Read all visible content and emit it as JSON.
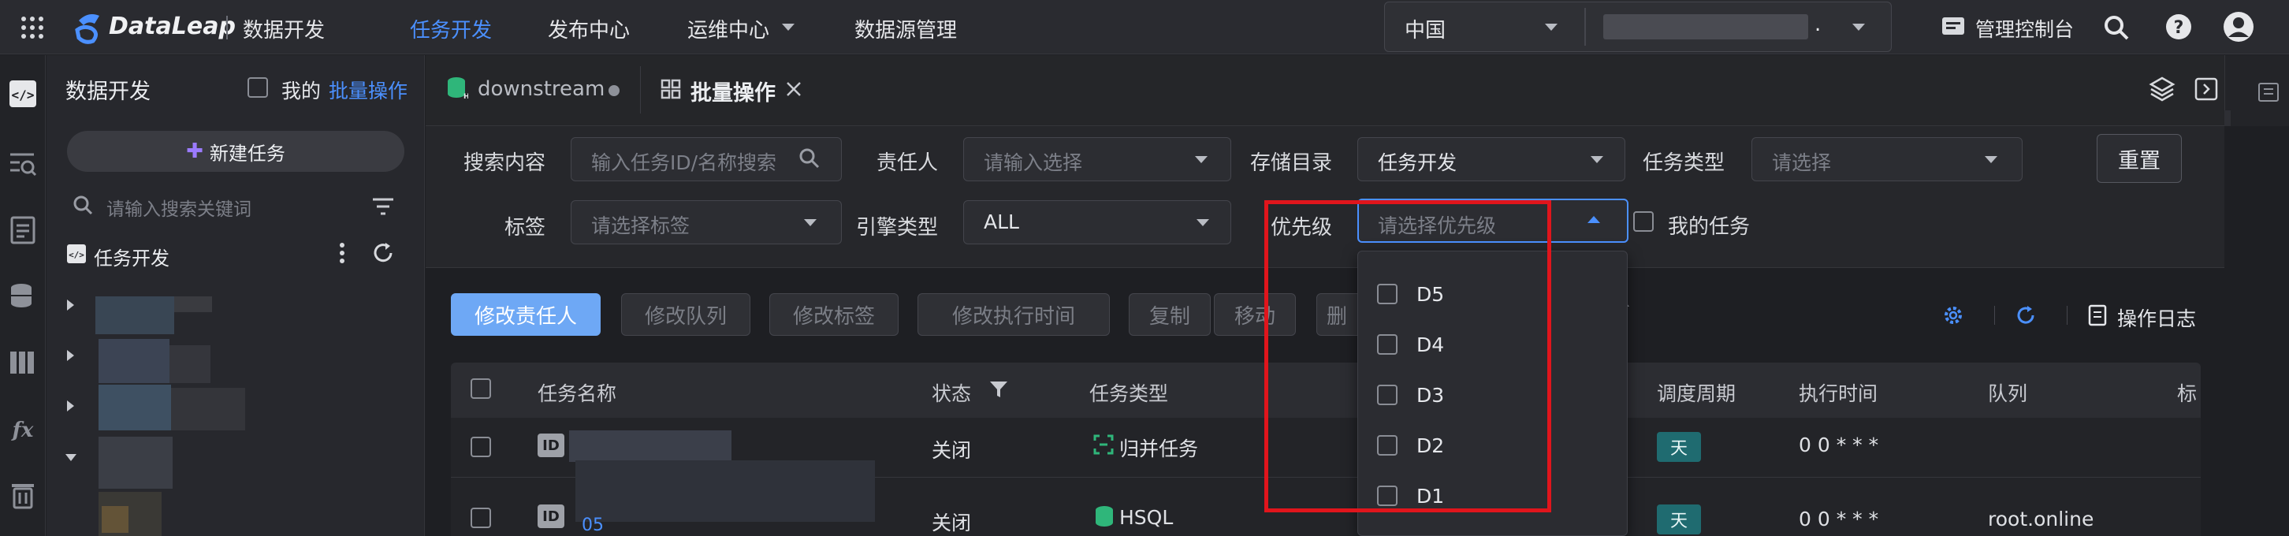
{
  "topbar": {
    "brand": "DataLeap",
    "product": "数据开发",
    "nav": [
      "任务开发",
      "发布中心",
      "运维中心",
      "数据源管理"
    ],
    "region": "中国",
    "account": ".",
    "console": "管理控制台",
    "colors": {
      "accent": "#4b90ff",
      "highlight": "#e0151c"
    }
  },
  "sidebar": {
    "title": "数据开发",
    "my_label": "我的",
    "batch_label": "批量操作",
    "new_task": "新建任务",
    "search_placeholder": "请输入搜索关键词",
    "tree_root": "任务开发"
  },
  "tabs": [
    {
      "label": "downstream"
    },
    {
      "label": "批量操作"
    }
  ],
  "filters": {
    "search_label": "搜索内容",
    "search_placeholder": "输入任务ID/名称搜索",
    "owner_label": "责任人",
    "owner_placeholder": "请输入选择",
    "dir_label": "存储目录",
    "dir_value": "任务开发",
    "type_label": "任务类型",
    "type_placeholder": "请选择",
    "reset": "重置",
    "tag_label": "标签",
    "tag_placeholder": "请选择标签",
    "engine_label": "引擎类型",
    "engine_value": "ALL",
    "priority_label": "优先级",
    "priority_placeholder": "请选择优先级",
    "my_tasks": "我的任务"
  },
  "actions": {
    "buttons": [
      "修改责任人",
      "修改队列",
      "修改标签",
      "修改执行时间",
      "复制",
      "移动",
      "删"
    ],
    "log": "操作日志"
  },
  "table": {
    "headers": [
      "任务名称",
      "状态",
      "任务类型",
      "调度周期",
      "执行时间",
      "队列",
      "标"
    ],
    "rows": [
      {
        "id_badge": "ID",
        "status": "关闭",
        "type": "归并任务",
        "period": "天",
        "time": "0 0 * * *",
        "queue": ""
      },
      {
        "id_badge": "ID",
        "sub": "05",
        "status": "关闭",
        "type": "HSQL",
        "period": "天",
        "time": "0 0 * * *",
        "queue": "root.online"
      }
    ]
  },
  "priority_options": [
    "D5",
    "D4",
    "D3",
    "D2",
    "D1"
  ]
}
